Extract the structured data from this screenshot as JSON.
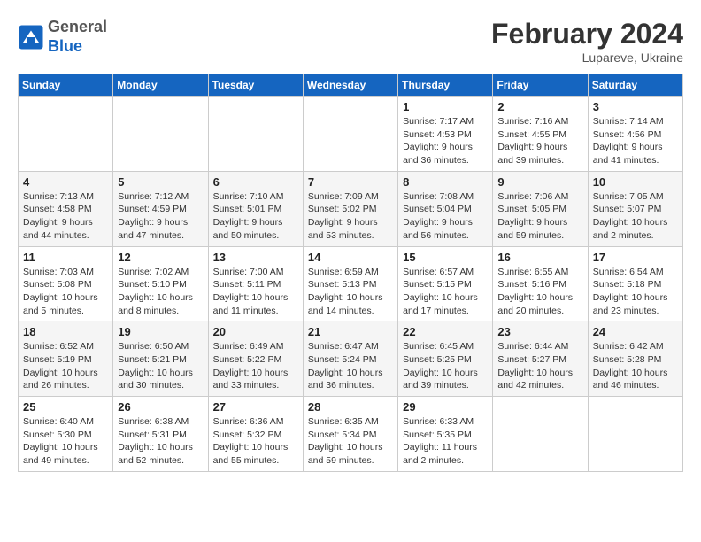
{
  "logo": {
    "line1": "General",
    "line2": "Blue"
  },
  "header": {
    "month": "February 2024",
    "location": "Lupareve, Ukraine"
  },
  "weekdays": [
    "Sunday",
    "Monday",
    "Tuesday",
    "Wednesday",
    "Thursday",
    "Friday",
    "Saturday"
  ],
  "weeks": [
    [
      {
        "day": "",
        "info": ""
      },
      {
        "day": "",
        "info": ""
      },
      {
        "day": "",
        "info": ""
      },
      {
        "day": "",
        "info": ""
      },
      {
        "day": "1",
        "info": "Sunrise: 7:17 AM\nSunset: 4:53 PM\nDaylight: 9 hours\nand 36 minutes."
      },
      {
        "day": "2",
        "info": "Sunrise: 7:16 AM\nSunset: 4:55 PM\nDaylight: 9 hours\nand 39 minutes."
      },
      {
        "day": "3",
        "info": "Sunrise: 7:14 AM\nSunset: 4:56 PM\nDaylight: 9 hours\nand 41 minutes."
      }
    ],
    [
      {
        "day": "4",
        "info": "Sunrise: 7:13 AM\nSunset: 4:58 PM\nDaylight: 9 hours\nand 44 minutes."
      },
      {
        "day": "5",
        "info": "Sunrise: 7:12 AM\nSunset: 4:59 PM\nDaylight: 9 hours\nand 47 minutes."
      },
      {
        "day": "6",
        "info": "Sunrise: 7:10 AM\nSunset: 5:01 PM\nDaylight: 9 hours\nand 50 minutes."
      },
      {
        "day": "7",
        "info": "Sunrise: 7:09 AM\nSunset: 5:02 PM\nDaylight: 9 hours\nand 53 minutes."
      },
      {
        "day": "8",
        "info": "Sunrise: 7:08 AM\nSunset: 5:04 PM\nDaylight: 9 hours\nand 56 minutes."
      },
      {
        "day": "9",
        "info": "Sunrise: 7:06 AM\nSunset: 5:05 PM\nDaylight: 9 hours\nand 59 minutes."
      },
      {
        "day": "10",
        "info": "Sunrise: 7:05 AM\nSunset: 5:07 PM\nDaylight: 10 hours\nand 2 minutes."
      }
    ],
    [
      {
        "day": "11",
        "info": "Sunrise: 7:03 AM\nSunset: 5:08 PM\nDaylight: 10 hours\nand 5 minutes."
      },
      {
        "day": "12",
        "info": "Sunrise: 7:02 AM\nSunset: 5:10 PM\nDaylight: 10 hours\nand 8 minutes."
      },
      {
        "day": "13",
        "info": "Sunrise: 7:00 AM\nSunset: 5:11 PM\nDaylight: 10 hours\nand 11 minutes."
      },
      {
        "day": "14",
        "info": "Sunrise: 6:59 AM\nSunset: 5:13 PM\nDaylight: 10 hours\nand 14 minutes."
      },
      {
        "day": "15",
        "info": "Sunrise: 6:57 AM\nSunset: 5:15 PM\nDaylight: 10 hours\nand 17 minutes."
      },
      {
        "day": "16",
        "info": "Sunrise: 6:55 AM\nSunset: 5:16 PM\nDaylight: 10 hours\nand 20 minutes."
      },
      {
        "day": "17",
        "info": "Sunrise: 6:54 AM\nSunset: 5:18 PM\nDaylight: 10 hours\nand 23 minutes."
      }
    ],
    [
      {
        "day": "18",
        "info": "Sunrise: 6:52 AM\nSunset: 5:19 PM\nDaylight: 10 hours\nand 26 minutes."
      },
      {
        "day": "19",
        "info": "Sunrise: 6:50 AM\nSunset: 5:21 PM\nDaylight: 10 hours\nand 30 minutes."
      },
      {
        "day": "20",
        "info": "Sunrise: 6:49 AM\nSunset: 5:22 PM\nDaylight: 10 hours\nand 33 minutes."
      },
      {
        "day": "21",
        "info": "Sunrise: 6:47 AM\nSunset: 5:24 PM\nDaylight: 10 hours\nand 36 minutes."
      },
      {
        "day": "22",
        "info": "Sunrise: 6:45 AM\nSunset: 5:25 PM\nDaylight: 10 hours\nand 39 minutes."
      },
      {
        "day": "23",
        "info": "Sunrise: 6:44 AM\nSunset: 5:27 PM\nDaylight: 10 hours\nand 42 minutes."
      },
      {
        "day": "24",
        "info": "Sunrise: 6:42 AM\nSunset: 5:28 PM\nDaylight: 10 hours\nand 46 minutes."
      }
    ],
    [
      {
        "day": "25",
        "info": "Sunrise: 6:40 AM\nSunset: 5:30 PM\nDaylight: 10 hours\nand 49 minutes."
      },
      {
        "day": "26",
        "info": "Sunrise: 6:38 AM\nSunset: 5:31 PM\nDaylight: 10 hours\nand 52 minutes."
      },
      {
        "day": "27",
        "info": "Sunrise: 6:36 AM\nSunset: 5:32 PM\nDaylight: 10 hours\nand 55 minutes."
      },
      {
        "day": "28",
        "info": "Sunrise: 6:35 AM\nSunset: 5:34 PM\nDaylight: 10 hours\nand 59 minutes."
      },
      {
        "day": "29",
        "info": "Sunrise: 6:33 AM\nSunset: 5:35 PM\nDaylight: 11 hours\nand 2 minutes."
      },
      {
        "day": "",
        "info": ""
      },
      {
        "day": "",
        "info": ""
      }
    ]
  ]
}
